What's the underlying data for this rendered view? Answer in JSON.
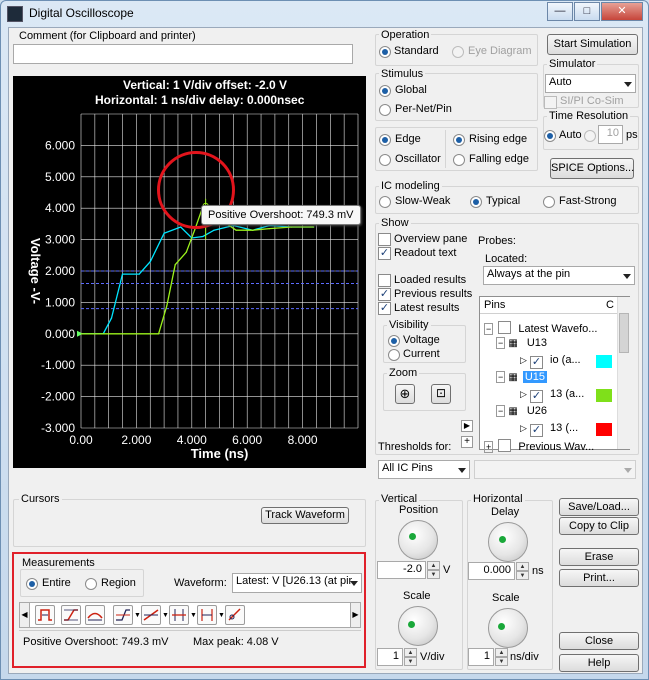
{
  "window": {
    "title": "Digital Oscilloscope"
  },
  "comment": {
    "label": "Comment (for Clipboard and printer)",
    "value": ""
  },
  "scope": {
    "header_line1": "Vertical: 1  V/div  offset: -2.0 V",
    "header_line2": "Horizontal: 1 ns/div  delay: 0.000nsec",
    "tooltip": "Positive Overshoot: 749.3 mV"
  },
  "chart_data": {
    "type": "line",
    "xlabel": "Time  (ns)",
    "ylabel": "Voltage  -V-",
    "xlim": [
      0,
      10
    ],
    "ylim": [
      -3,
      7
    ],
    "x_ticks": [
      "0.00",
      "2.000",
      "4.000",
      "6.000",
      "8.000"
    ],
    "y_ticks": [
      "6.000",
      "5.000",
      "4.000",
      "3.000",
      "2.000",
      "1.000",
      "0.000",
      "-1.000",
      "-2.000",
      "-3.000"
    ],
    "grid": true,
    "thresholds": [
      2.0,
      1.6,
      0.8
    ],
    "series": [
      {
        "name": "io (a...",
        "color": "#00e5ff",
        "points": [
          [
            0,
            0
          ],
          [
            0.8,
            0
          ],
          [
            1.1,
            0.5
          ],
          [
            1.5,
            1.9
          ],
          [
            2.1,
            1.9
          ],
          [
            2.5,
            2.3
          ],
          [
            3.0,
            3.2
          ],
          [
            3.6,
            3.4
          ],
          [
            4.0,
            3.05
          ],
          [
            4.4,
            3.1
          ],
          [
            4.8,
            3.3
          ],
          [
            5.5,
            3.45
          ],
          [
            6.2,
            3.3
          ],
          [
            6.8,
            3.45
          ],
          [
            7.6,
            3.4
          ],
          [
            8.4,
            3.4
          ]
        ]
      },
      {
        "name": "13 (a...",
        "color": "#9cf31c",
        "points": [
          [
            0,
            0
          ],
          [
            2.8,
            0
          ],
          [
            3.1,
            0.9
          ],
          [
            3.4,
            2.2
          ],
          [
            3.8,
            2.6
          ],
          [
            4.1,
            3.3
          ],
          [
            4.4,
            4.05
          ],
          [
            4.55,
            4.08
          ],
          [
            4.75,
            3.9
          ],
          [
            5.1,
            3.6
          ],
          [
            5.6,
            3.3
          ],
          [
            6.2,
            3.3
          ],
          [
            6.8,
            3.35
          ],
          [
            7.6,
            3.4
          ],
          [
            8.4,
            3.4
          ]
        ]
      }
    ]
  },
  "operation": {
    "title": "Operation",
    "standard": "Standard",
    "eye": "Eye Diagram"
  },
  "buttons": {
    "start": "Start Simulation",
    "spice": "SPICE Options...",
    "track": "Track Waveform",
    "save_load": "Save/Load...",
    "copy": "Copy to Clip",
    "erase": "Erase",
    "print": "Print...",
    "close": "Close",
    "help": "Help"
  },
  "simulator": {
    "title": "Simulator",
    "value": "Auto",
    "sipi": "SI/PI Co-Sim"
  },
  "stimulus": {
    "title": "Stimulus",
    "global": "Global",
    "pernet": "Per-Net/Pin"
  },
  "edge": {
    "edge": "Edge",
    "oscillator": "Oscillator",
    "rising": "Rising edge",
    "falling": "Falling edge"
  },
  "time_resolution": {
    "title": "Time Resolution",
    "auto": "Auto",
    "value": "10",
    "unit": "ps"
  },
  "ic_modeling": {
    "title": "IC modeling",
    "slow": "Slow-Weak",
    "typical": "Typical",
    "fast": "Fast-Strong"
  },
  "show": {
    "title": "Show",
    "overview": "Overview pane",
    "readout": "Readout text",
    "loaded": "Loaded results",
    "previous": "Previous results",
    "latest": "Latest results",
    "visibility": "Visibility",
    "voltage": "Voltage",
    "current": "Current",
    "zoom": "Zoom"
  },
  "probes": {
    "title": "Probes:",
    "located": "Located:",
    "location": "Always at the pin"
  },
  "tree": {
    "col_pins": "Pins",
    "col_c": "C",
    "latest": "Latest Wavefo...",
    "u13": "U13",
    "io": "io (a...",
    "u15": "U15",
    "pin15": "13 (a...",
    "u26": "U26",
    "pin26": "13 (...",
    "previous": "Previous Wav...",
    "color_io": "#00ffff",
    "color_15": "#7fe01a",
    "color_26": "#ff0000"
  },
  "thresholds": {
    "label": "Thresholds for:",
    "value": "All IC Pins"
  },
  "cursors": {
    "title": "Cursors"
  },
  "measurements": {
    "title": "Measurements",
    "entire": "Entire",
    "region": "Region",
    "waveform_label": "Waveform:",
    "waveform_value": "Latest: V [U26.13 (at pir",
    "overshoot": "Positive Overshoot: 749.3 mV",
    "maxpeak": "Max peak:  4.08 V"
  },
  "vertical": {
    "title": "Vertical",
    "position": "Position",
    "position_value": "-2.0",
    "position_unit": "V",
    "scale": "Scale",
    "scale_value": "1",
    "scale_unit": "V/div"
  },
  "horizontal": {
    "title": "Horizontal",
    "delay": "Delay",
    "delay_value": "0.000",
    "delay_unit": "ns",
    "scale": "Scale",
    "scale_value": "1",
    "scale_unit": "ns/div"
  }
}
